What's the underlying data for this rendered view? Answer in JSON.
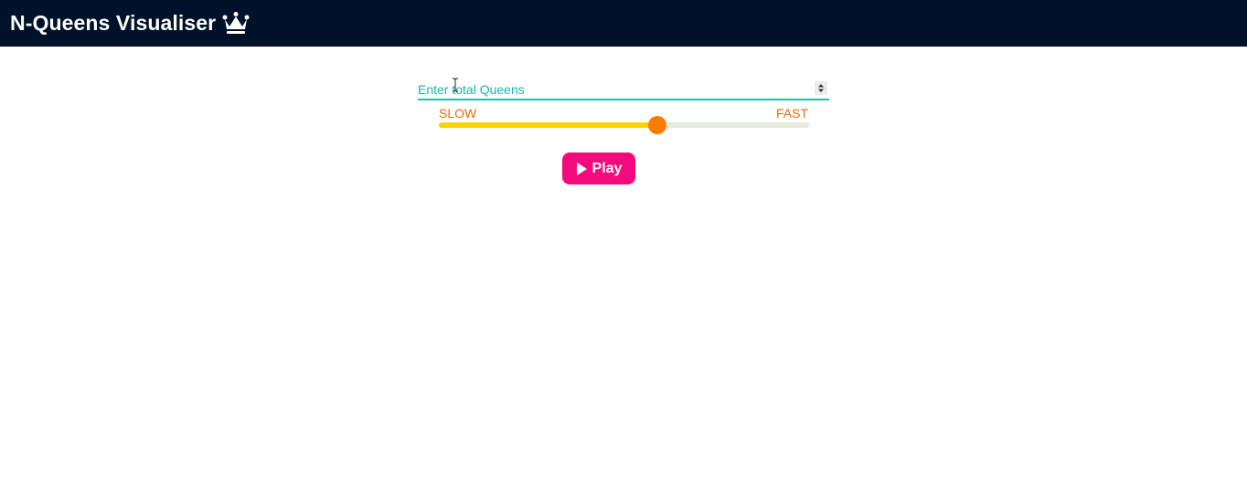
{
  "header": {
    "title": "N-Queens Visualiser",
    "icon": "crown-icon",
    "background": "#001229"
  },
  "controls": {
    "queens_input": {
      "placeholder": "Enter total Queens",
      "value": ""
    },
    "speed": {
      "slow_label": "SLOW",
      "fast_label": "FAST",
      "value_fraction": 0.59
    },
    "play_button": {
      "label": "Play",
      "icon": "play-icon"
    }
  },
  "colors": {
    "accent_teal": "#1fc0b3",
    "label_orange": "#e66a0a",
    "slider_fill": "#f7d500",
    "slider_thumb": "#ff7a00",
    "play_button": "#f50a7e"
  }
}
